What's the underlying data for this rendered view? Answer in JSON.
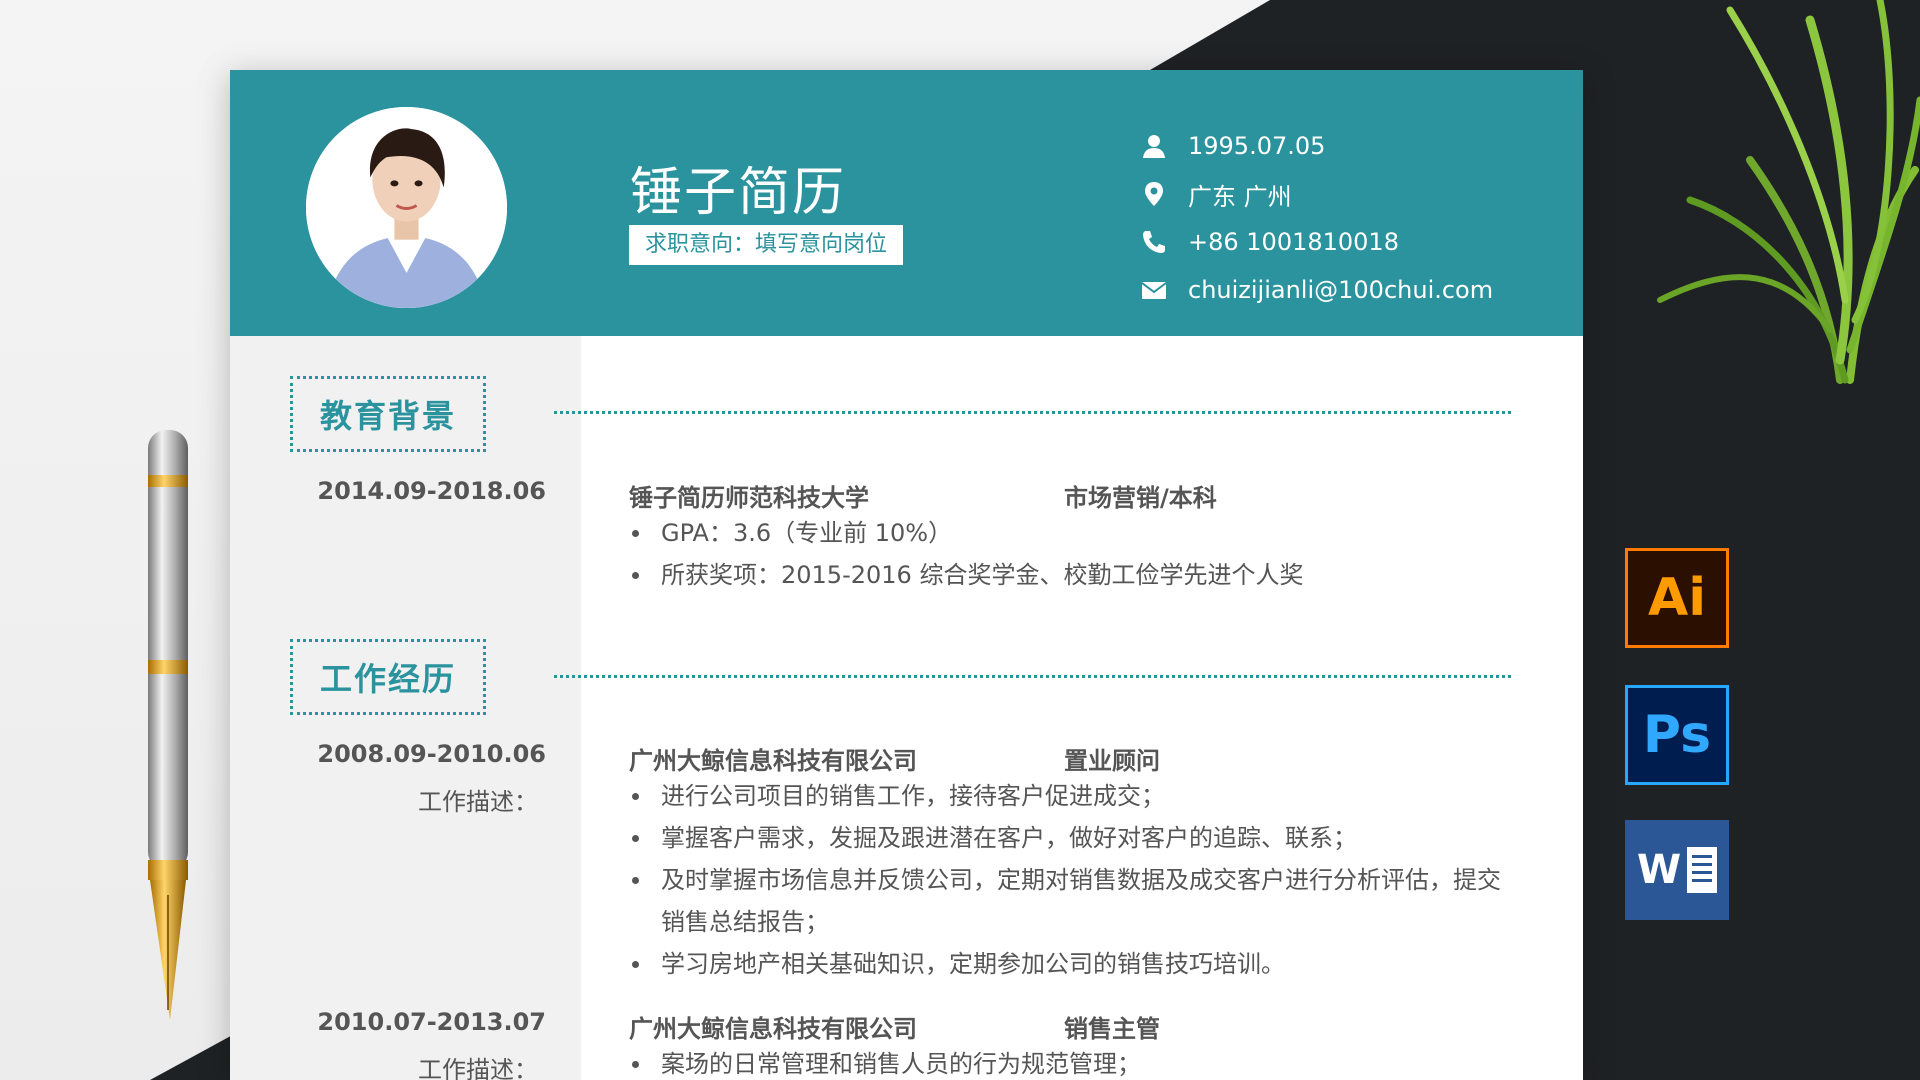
{
  "resume": {
    "name": "锤子简历",
    "intent": "求职意向：填写意向岗位",
    "contact": {
      "birth": "1995.07.05",
      "location": "广东 广州",
      "phone": "+86 1001810018",
      "email": "chuizijianli@100chui.com"
    },
    "education": {
      "title": "教育背景",
      "date": "2014.09-2018.06",
      "school": "锤子简历师范科技大学",
      "major": "市场营销/本科",
      "bullets": [
        "GPA：3.6（专业前 10%）",
        "所获奖项：2015-2016 综合奖学金、校勤工俭学先进个人奖"
      ]
    },
    "work": {
      "title": "工作经历",
      "jobs": [
        {
          "date": "2008.09-2010.06",
          "desc_label": "工作描述：",
          "company": "广州大鲸信息科技有限公司",
          "role": "置业顾问",
          "bullets": [
            "进行公司项目的销售工作，接待客户促进成交；",
            "掌握客户需求，发掘及跟进潜在客户，做好对客户的追踪、联系；",
            "及时掌握市场信息并反馈公司，定期对销售数据及成交客户进行分析评估，提交销售总结报告；",
            "学习房地产相关基础知识，定期参加公司的销售技巧培训。"
          ]
        },
        {
          "date": "2010.07-2013.07",
          "desc_label": "工作描述：",
          "company": "广州大鲸信息科技有限公司",
          "role": "销售主管",
          "bullets": [
            "案场的日常管理和销售人员的行为规范管理；"
          ]
        }
      ]
    }
  },
  "icons": {
    "ai_label": "Ai",
    "ps_label": "Ps",
    "word_label": "W"
  },
  "colors": {
    "accent": "#2a939e"
  }
}
